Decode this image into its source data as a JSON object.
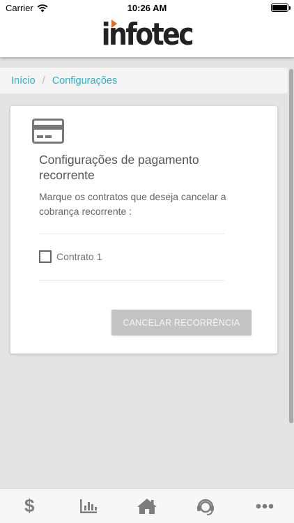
{
  "status_bar": {
    "carrier": "Carrier",
    "time": "10:26 AM"
  },
  "header": {
    "logo": "infotec",
    "logo_accent_color": "#e06a1c"
  },
  "breadcrumb": {
    "home": "Início",
    "separator": "/",
    "current": "Configurações"
  },
  "card": {
    "icon": "credit-card-icon",
    "title": "Configurações de pagamento recorrente",
    "description": "Marque os contratos que deseja cancelar a cobrança recorrente :",
    "contracts": [
      {
        "label": "Contrato 1",
        "checked": false
      }
    ],
    "cancel_button": "CANCELAR RECORRÊNCIA"
  },
  "tabbar": {
    "items": [
      {
        "icon": "dollar-icon",
        "glyph": "$"
      },
      {
        "icon": "bar-chart-icon"
      },
      {
        "icon": "home-icon"
      },
      {
        "icon": "headset-icon"
      },
      {
        "icon": "more-icon"
      }
    ]
  },
  "colors": {
    "link": "#2ab2c9",
    "icon": "#7d7d7d",
    "button_disabled": "#c3c3c3"
  }
}
